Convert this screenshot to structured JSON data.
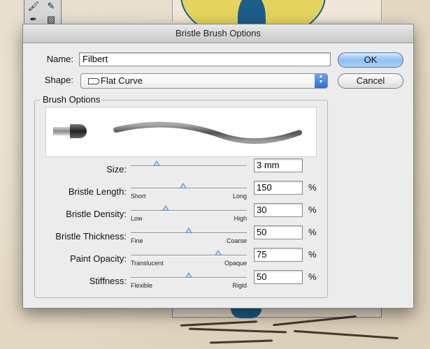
{
  "dialog": {
    "title": "Bristle Brush Options",
    "name_label": "Name:",
    "name_value": "Filbert",
    "shape_label": "Shape:",
    "shape_value": "Flat Curve",
    "shape_icon": "flat-brush-icon",
    "ok_label": "OK",
    "cancel_label": "Cancel",
    "group_title": "Brush Options"
  },
  "sliders": [
    {
      "label": "Size:",
      "min_label": "",
      "max_label": "",
      "value": "3 mm",
      "unit": "",
      "level": 0.22
    },
    {
      "label": "Bristle Length:",
      "min_label": "Short",
      "max_label": "Long",
      "value": "150",
      "unit": "%",
      "level": 0.45
    },
    {
      "label": "Bristle Density:",
      "min_label": "Low",
      "max_label": "High",
      "value": "30",
      "unit": "%",
      "level": 0.3
    },
    {
      "label": "Bristle Thickness:",
      "min_label": "Fine",
      "max_label": "Coarse",
      "value": "50",
      "unit": "%",
      "level": 0.5
    },
    {
      "label": "Paint Opacity:",
      "min_label": "Translucent",
      "max_label": "Opaque",
      "value": "75",
      "unit": "%",
      "level": 0.75
    },
    {
      "label": "Stiffness:",
      "min_label": "Flexible",
      "max_label": "Rigid",
      "value": "50",
      "unit": "%",
      "level": 0.5
    }
  ],
  "colors": {
    "accent": "#5c86b8",
    "art_yellow": "#e4d45e",
    "art_blue": "#1c5d8a"
  },
  "tools": [
    "paintbrush-icon",
    "pencil-icon",
    "blob-brush-icon",
    "eraser-icon"
  ]
}
